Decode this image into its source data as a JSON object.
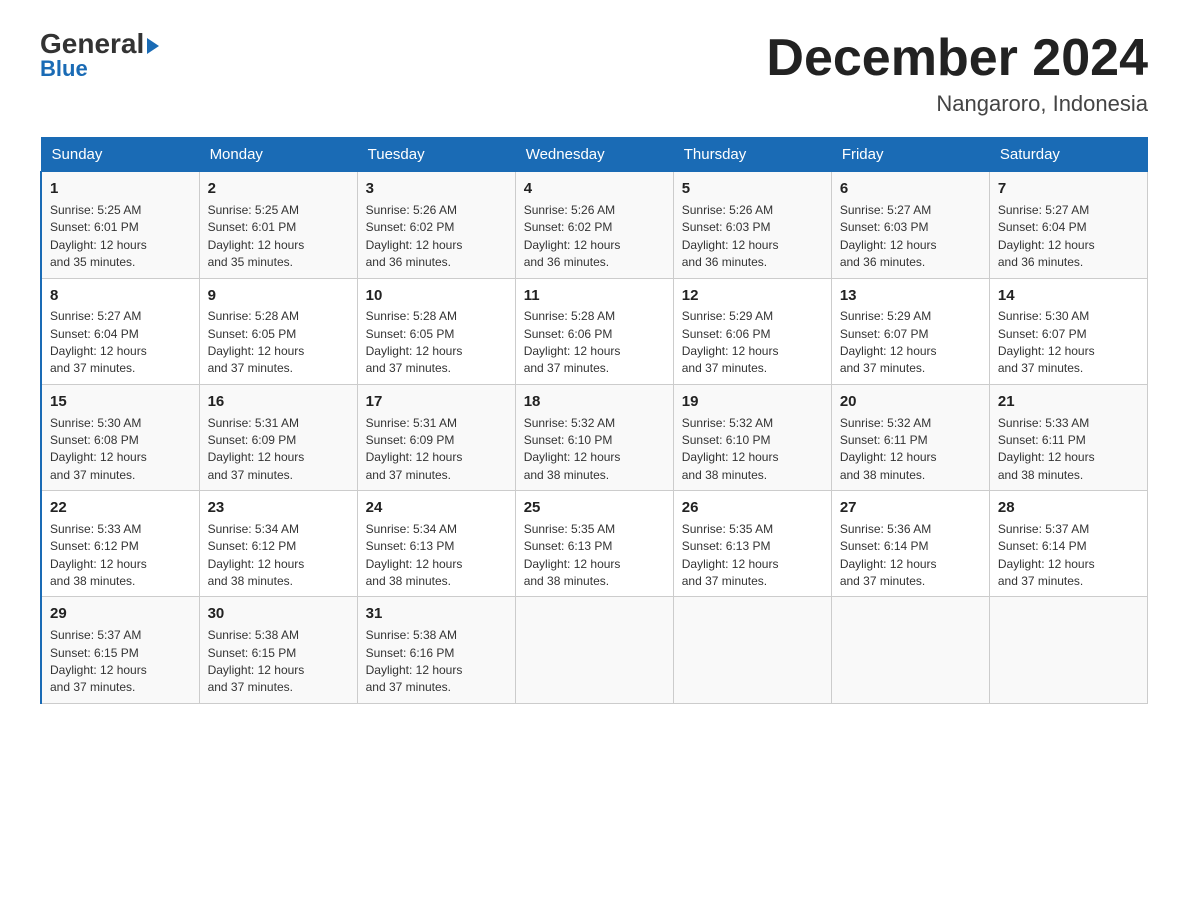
{
  "logo": {
    "general": "General",
    "triangle": "▶",
    "blue": "Blue"
  },
  "title": "December 2024",
  "location": "Nangaroro, Indonesia",
  "days_of_week": [
    "Sunday",
    "Monday",
    "Tuesday",
    "Wednesday",
    "Thursday",
    "Friday",
    "Saturday"
  ],
  "weeks": [
    [
      {
        "day": "1",
        "sunrise": "5:25 AM",
        "sunset": "6:01 PM",
        "daylight": "12 hours and 35 minutes."
      },
      {
        "day": "2",
        "sunrise": "5:25 AM",
        "sunset": "6:01 PM",
        "daylight": "12 hours and 35 minutes."
      },
      {
        "day": "3",
        "sunrise": "5:26 AM",
        "sunset": "6:02 PM",
        "daylight": "12 hours and 36 minutes."
      },
      {
        "day": "4",
        "sunrise": "5:26 AM",
        "sunset": "6:02 PM",
        "daylight": "12 hours and 36 minutes."
      },
      {
        "day": "5",
        "sunrise": "5:26 AM",
        "sunset": "6:03 PM",
        "daylight": "12 hours and 36 minutes."
      },
      {
        "day": "6",
        "sunrise": "5:27 AM",
        "sunset": "6:03 PM",
        "daylight": "12 hours and 36 minutes."
      },
      {
        "day": "7",
        "sunrise": "5:27 AM",
        "sunset": "6:04 PM",
        "daylight": "12 hours and 36 minutes."
      }
    ],
    [
      {
        "day": "8",
        "sunrise": "5:27 AM",
        "sunset": "6:04 PM",
        "daylight": "12 hours and 37 minutes."
      },
      {
        "day": "9",
        "sunrise": "5:28 AM",
        "sunset": "6:05 PM",
        "daylight": "12 hours and 37 minutes."
      },
      {
        "day": "10",
        "sunrise": "5:28 AM",
        "sunset": "6:05 PM",
        "daylight": "12 hours and 37 minutes."
      },
      {
        "day": "11",
        "sunrise": "5:28 AM",
        "sunset": "6:06 PM",
        "daylight": "12 hours and 37 minutes."
      },
      {
        "day": "12",
        "sunrise": "5:29 AM",
        "sunset": "6:06 PM",
        "daylight": "12 hours and 37 minutes."
      },
      {
        "day": "13",
        "sunrise": "5:29 AM",
        "sunset": "6:07 PM",
        "daylight": "12 hours and 37 minutes."
      },
      {
        "day": "14",
        "sunrise": "5:30 AM",
        "sunset": "6:07 PM",
        "daylight": "12 hours and 37 minutes."
      }
    ],
    [
      {
        "day": "15",
        "sunrise": "5:30 AM",
        "sunset": "6:08 PM",
        "daylight": "12 hours and 37 minutes."
      },
      {
        "day": "16",
        "sunrise": "5:31 AM",
        "sunset": "6:09 PM",
        "daylight": "12 hours and 37 minutes."
      },
      {
        "day": "17",
        "sunrise": "5:31 AM",
        "sunset": "6:09 PM",
        "daylight": "12 hours and 37 minutes."
      },
      {
        "day": "18",
        "sunrise": "5:32 AM",
        "sunset": "6:10 PM",
        "daylight": "12 hours and 38 minutes."
      },
      {
        "day": "19",
        "sunrise": "5:32 AM",
        "sunset": "6:10 PM",
        "daylight": "12 hours and 38 minutes."
      },
      {
        "day": "20",
        "sunrise": "5:32 AM",
        "sunset": "6:11 PM",
        "daylight": "12 hours and 38 minutes."
      },
      {
        "day": "21",
        "sunrise": "5:33 AM",
        "sunset": "6:11 PM",
        "daylight": "12 hours and 38 minutes."
      }
    ],
    [
      {
        "day": "22",
        "sunrise": "5:33 AM",
        "sunset": "6:12 PM",
        "daylight": "12 hours and 38 minutes."
      },
      {
        "day": "23",
        "sunrise": "5:34 AM",
        "sunset": "6:12 PM",
        "daylight": "12 hours and 38 minutes."
      },
      {
        "day": "24",
        "sunrise": "5:34 AM",
        "sunset": "6:13 PM",
        "daylight": "12 hours and 38 minutes."
      },
      {
        "day": "25",
        "sunrise": "5:35 AM",
        "sunset": "6:13 PM",
        "daylight": "12 hours and 38 minutes."
      },
      {
        "day": "26",
        "sunrise": "5:35 AM",
        "sunset": "6:13 PM",
        "daylight": "12 hours and 37 minutes."
      },
      {
        "day": "27",
        "sunrise": "5:36 AM",
        "sunset": "6:14 PM",
        "daylight": "12 hours and 37 minutes."
      },
      {
        "day": "28",
        "sunrise": "5:37 AM",
        "sunset": "6:14 PM",
        "daylight": "12 hours and 37 minutes."
      }
    ],
    [
      {
        "day": "29",
        "sunrise": "5:37 AM",
        "sunset": "6:15 PM",
        "daylight": "12 hours and 37 minutes."
      },
      {
        "day": "30",
        "sunrise": "5:38 AM",
        "sunset": "6:15 PM",
        "daylight": "12 hours and 37 minutes."
      },
      {
        "day": "31",
        "sunrise": "5:38 AM",
        "sunset": "6:16 PM",
        "daylight": "12 hours and 37 minutes."
      },
      {
        "day": "",
        "sunrise": "",
        "sunset": "",
        "daylight": ""
      },
      {
        "day": "",
        "sunrise": "",
        "sunset": "",
        "daylight": ""
      },
      {
        "day": "",
        "sunrise": "",
        "sunset": "",
        "daylight": ""
      },
      {
        "day": "",
        "sunrise": "",
        "sunset": "",
        "daylight": ""
      }
    ]
  ],
  "labels": {
    "sunrise": "Sunrise: ",
    "sunset": "Sunset: ",
    "daylight": "Daylight: "
  }
}
